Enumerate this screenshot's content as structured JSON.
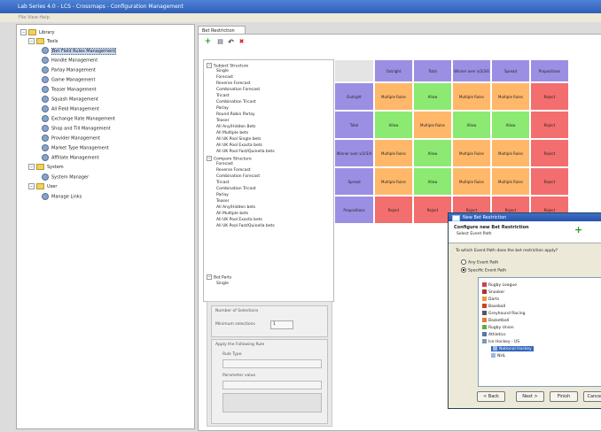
{
  "window": {
    "title": "Lab Series 4.0 - LCS - Crossmaps - Configuration Management"
  },
  "menubar": {
    "text": "File View Help"
  },
  "sidebar": {
    "root": "Library",
    "group_tools": "Tools",
    "items": [
      "Bet Field Rules Management",
      "Handle Management",
      "Parlay Management",
      "Game Management",
      "Teaser Management",
      "Squash Management",
      "All Field Management",
      "Exchange Rate Management",
      "Shop and Till Management",
      "Provider Management",
      "Market Type Management",
      "Affiliate Management"
    ],
    "group_system": "System",
    "system_items": [
      "System Manager"
    ],
    "group_user": "User",
    "user_items": [
      "Manage Links"
    ]
  },
  "tab": {
    "label": "Bet Restriction"
  },
  "toolbar": {
    "add": "+",
    "save": "▤",
    "undo": "↶",
    "delete": "✖"
  },
  "bet_list": {
    "group1": "Subject Structure",
    "group1_items": [
      "Single",
      "Forecast",
      "Reverse Forecast",
      "Combination Forecast",
      "Tricast",
      "Combination Tricast",
      "Parlay",
      "Round Robin Parlay",
      "Teaser",
      "All Any/Hidden Bets",
      "All Multiple bets",
      "All UK Pool Single bets",
      "All UK Pool Exacta bets",
      "All UK Pool Fast/Quinella bets"
    ],
    "group2": "Compare Structure",
    "group2_items": [
      "Forecast",
      "Reverse Forecast",
      "Combination Forecast",
      "Tricast",
      "Combination Tricast",
      "Parlay",
      "Teaser",
      "All Any/Hidden bets",
      "All Multiple bets",
      "All UK Pool Exacta bets",
      "All UK Pool Fast/Quinella bets"
    ],
    "group3": "Bet Parts",
    "group3_items": [
      "Single"
    ]
  },
  "settings": {
    "group1_title": "Number of Selections",
    "min_label": "Minimum selections",
    "min_value": "1",
    "group2_title": "Apply the Following Rule",
    "rule_label": "Rule Type",
    "rule_value": "",
    "param_label": "Parameter value",
    "param_value": ""
  },
  "matrix": {
    "columns": [
      "Outright",
      "Total",
      "Winner over x/2/3/4",
      "Spread",
      "Propositions"
    ],
    "rows": [
      {
        "label": "Outright",
        "cells": [
          "Multiple Rules",
          "Allow",
          "Multiple Rules",
          "Multiple Rules",
          "Reject"
        ]
      },
      {
        "label": "Total",
        "cells": [
          "Allow",
          "Multiple Rules",
          "Allow",
          "Allow",
          "Reject"
        ]
      },
      {
        "label": "Winner over x/2/3/4",
        "cells": [
          "Multiple Rules",
          "Allow",
          "Multiple Rules",
          "Multiple Rules",
          "Reject"
        ]
      },
      {
        "label": "Spread",
        "cells": [
          "Multiple Rules",
          "Allow",
          "Multiple Rules",
          "Multiple Rules",
          "Reject"
        ]
      },
      {
        "label": "Propositions",
        "cells": [
          "Reject",
          "Reject",
          "Reject",
          "Reject",
          "Reject"
        ]
      }
    ],
    "colors": {
      "header": "#9b8fe4",
      "multiple": "#ffb86a",
      "allow": "#8cea72",
      "reject": "#f36e6e",
      "grid": "#e4e4e4"
    }
  },
  "dialog": {
    "title": "New Bet Restriction",
    "heading": "Configure new Bet Restriction",
    "subheading": "Select Event Path",
    "question": "To which Event Path does the bet restriction apply?",
    "option_any": "Any Event Path",
    "option_specific": "Specific Event Path",
    "tree": [
      "Rugby League",
      "Snooker",
      "Darts",
      "Baseball",
      "Greyhound Racing",
      "Basketball",
      "Rugby Union",
      "Athletics",
      "Ice Hockey - US",
      "National Hockey",
      "NHL"
    ],
    "buttons": {
      "back": "< Back",
      "next": "Next >",
      "finish": "Finish",
      "cancel": "Cancel"
    }
  }
}
